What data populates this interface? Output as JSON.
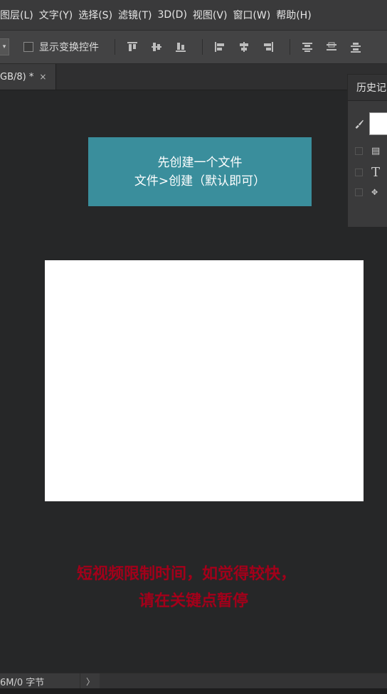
{
  "menubar": {
    "items": [
      "图层(L)",
      "文字(Y)",
      "选择(S)",
      "滤镜(T)",
      "3D(D)",
      "视图(V)",
      "窗口(W)",
      "帮助(H)"
    ]
  },
  "options": {
    "show_transform_label": "显示变换控件"
  },
  "document": {
    "tab_label": "GB/8) *",
    "close": "×"
  },
  "history_panel": {
    "title": "历史记"
  },
  "note": {
    "line1": "先创建一个文件",
    "line2": "文件>创建（默认即可）",
    "bg_color": "#3a8e9c"
  },
  "caption": {
    "line1": "短视频限制时间，如觉得较快，",
    "line2": "请在关键点暂停",
    "color": "#a3001a"
  },
  "status": {
    "text": "6M/0 字节",
    "arrow": "〉"
  }
}
